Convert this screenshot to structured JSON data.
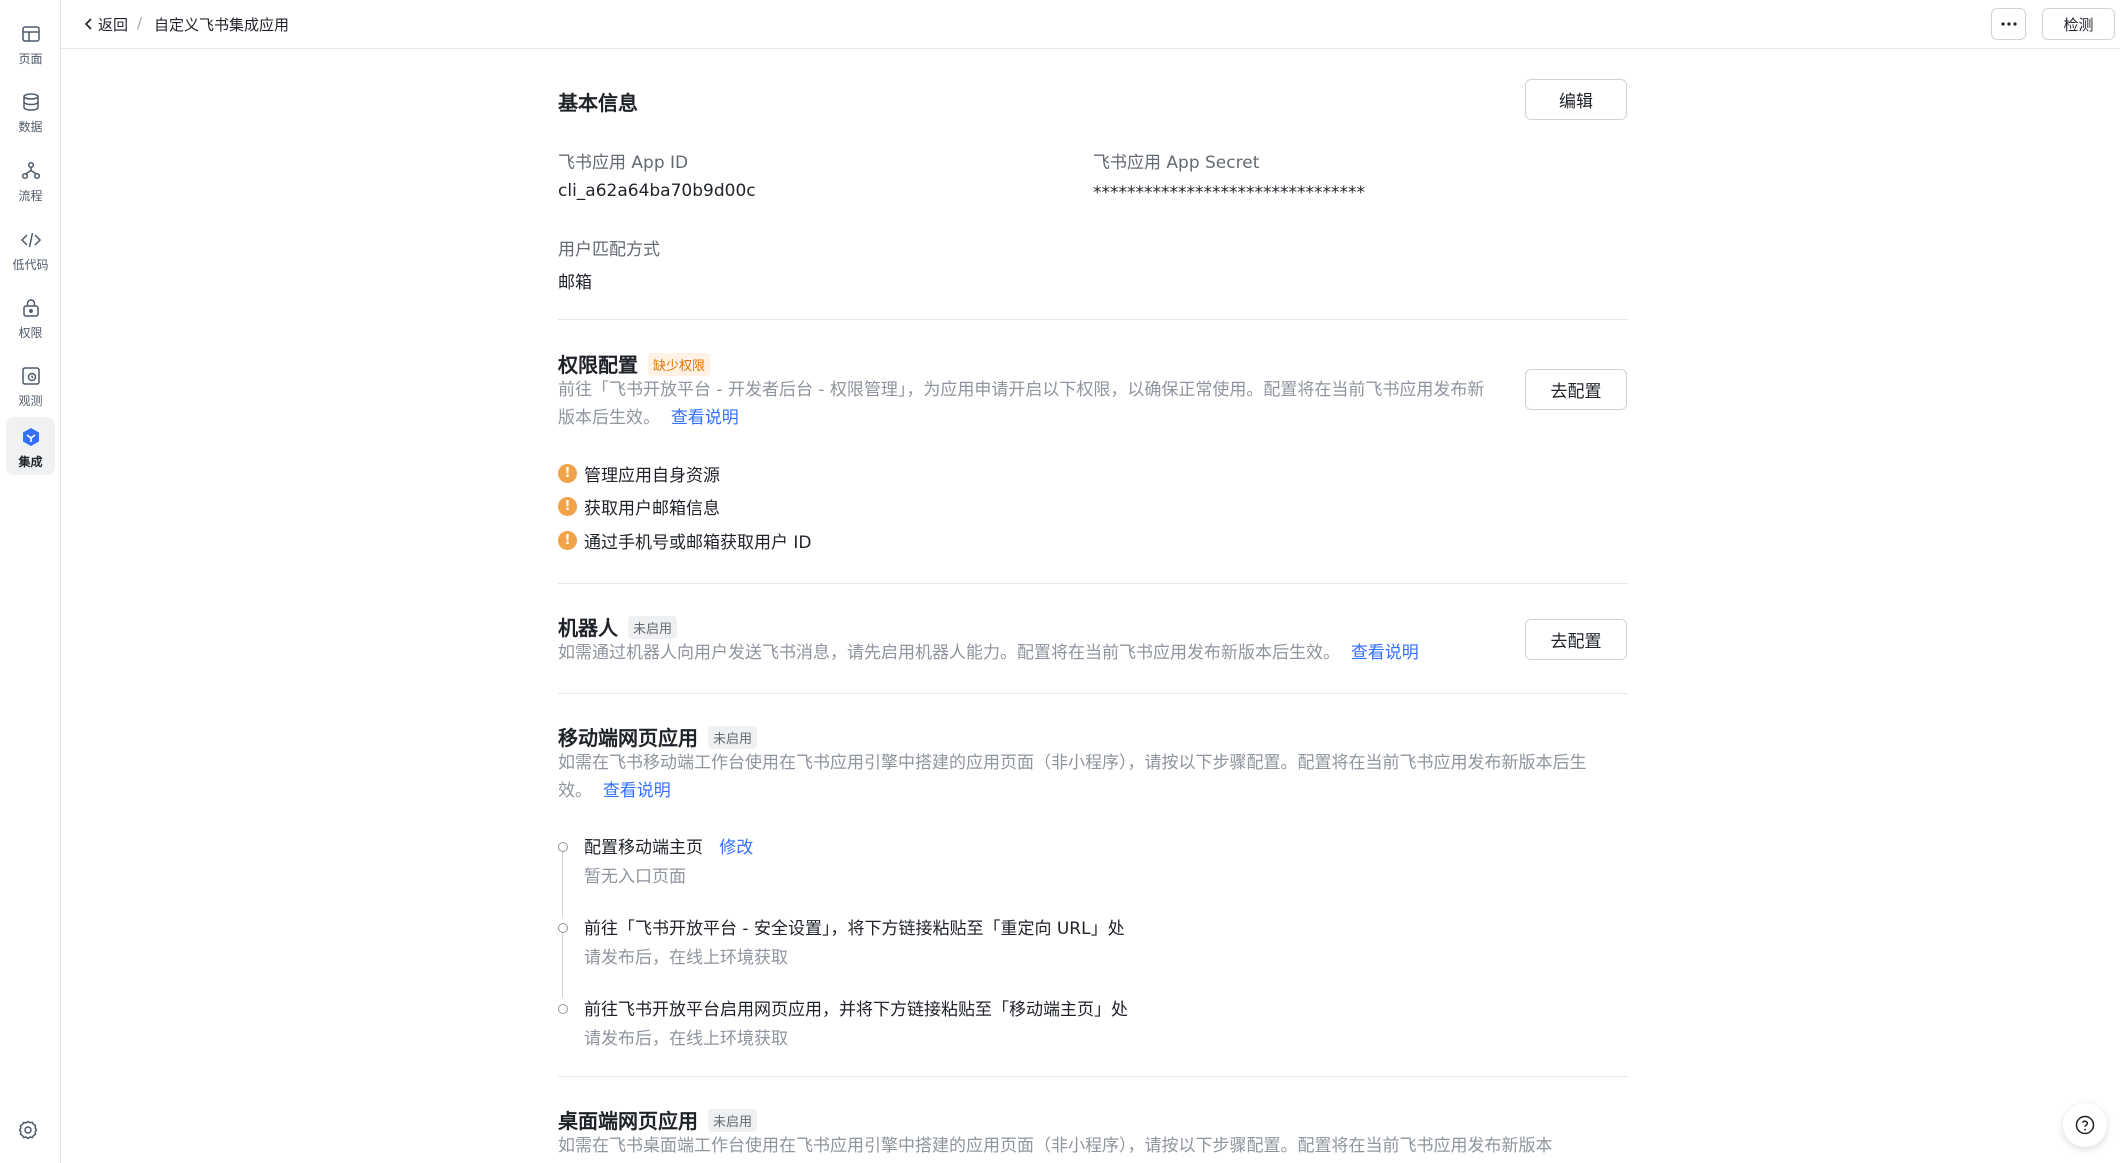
{
  "sidebar": {
    "items": [
      {
        "label": "页面",
        "icon": "layout-icon"
      },
      {
        "label": "数据",
        "icon": "database-icon"
      },
      {
        "label": "流程",
        "icon": "flow-icon"
      },
      {
        "label": "低代码",
        "icon": "code-icon"
      },
      {
        "label": "权限",
        "icon": "lock-icon"
      },
      {
        "label": "观测",
        "icon": "monitor-icon"
      },
      {
        "label": "集成",
        "icon": "integration-icon",
        "active": true
      }
    ]
  },
  "header": {
    "back_label": "返回",
    "separator": "/",
    "current": "自定义飞书集成应用",
    "more_label": "···",
    "check_label": "检测"
  },
  "basic": {
    "title": "基本信息",
    "edit_label": "编辑",
    "app_id_label": "飞书应用 App ID",
    "app_id_value": "cli_a62a64ba70b9d00c",
    "secret_label": "飞书应用 App Secret",
    "secret_value": "********************************",
    "match_label": "用户匹配方式",
    "match_value": "邮箱"
  },
  "permission": {
    "title": "权限配置",
    "badge": "缺少权限",
    "desc": "前往「飞书开放平台 - 开发者后台 - 权限管理」，为应用申请开启以下权限，以确保正常使用。配置将在当前飞书应用发布新版本后生效。",
    "link": "查看说明",
    "button": "去配置",
    "items": [
      "管理应用自身资源",
      "获取用户邮箱信息",
      "通过手机号或邮箱获取用户 ID"
    ],
    "warn_symbol": "!"
  },
  "robot": {
    "title": "机器人",
    "badge": "未启用",
    "desc": "如需通过机器人向用户发送飞书消息，请先启用机器人能力。配置将在当前飞书应用发布新版本后生效。",
    "link": "查看说明",
    "button": "去配置"
  },
  "mobile": {
    "title": "移动端网页应用",
    "badge": "未启用",
    "desc": "如需在飞书移动端工作台使用在飞书应用引擎中搭建的应用页面（非小程序），请按以下步骤配置。配置将在当前飞书应用发布新版本后生效。",
    "link": "查看说明",
    "steps": [
      {
        "title": "配置移动端主页",
        "action": "修改",
        "sub": "暂无入口页面"
      },
      {
        "title": "前往「飞书开放平台 - 安全设置」，将下方链接粘贴至「重定向 URL」处",
        "sub": "请发布后，在线上环境获取"
      },
      {
        "title": "前往飞书开放平台启用网页应用，并将下方链接粘贴至「移动端主页」处",
        "sub": "请发布后，在线上环境获取"
      }
    ]
  },
  "desktop": {
    "title": "桌面端网页应用",
    "badge": "未启用",
    "desc": "如需在飞书桌面端工作台使用在飞书应用引擎中搭建的应用页面（非小程序），请按以下步骤配置。配置将在当前飞书应用发布新版本"
  }
}
